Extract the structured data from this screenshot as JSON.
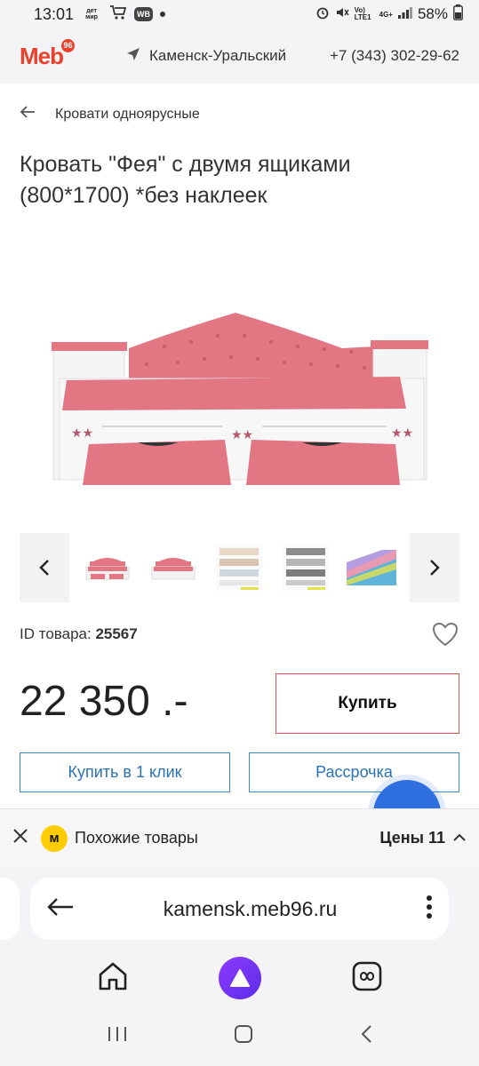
{
  "status_bar": {
    "time": "13:01",
    "app_badge_1": "дет мир",
    "app_badge_2": "WB",
    "network_1": "Vo) LTE1",
    "network_2": "4G+",
    "battery": "58%"
  },
  "header": {
    "logo_text": "Meb",
    "logo_badge": "96",
    "city": "Каменск-Уральский",
    "phone": "+7 (343) 302-29-62"
  },
  "breadcrumb": {
    "label": "Кровати одноярусные"
  },
  "product": {
    "title": "Кровать \"Фея\" с двумя ящиками (800*1700) *без наклеек",
    "id_label": "ID товара:",
    "id_value": "25567",
    "price": "22 350 .-",
    "buy_label": "Купить",
    "one_click_label": "Купить в 1 клик",
    "installment_label": "Рассрочка",
    "colors": {
      "upholstery": "#e27683",
      "frame": "#f7f7f7",
      "accent_red": "#d9534f",
      "accent_blue": "#3a86c8"
    }
  },
  "gallery": {
    "prev_icon": "chevron-left-icon",
    "next_icon": "chevron-right-icon",
    "thumbnail_count": 5
  },
  "similar_bar": {
    "label": "Похожие товары",
    "prices_label": "Цены",
    "prices_count": "11",
    "logo_letter": "м"
  },
  "browser": {
    "url": "kamensk.meb96.ru"
  }
}
